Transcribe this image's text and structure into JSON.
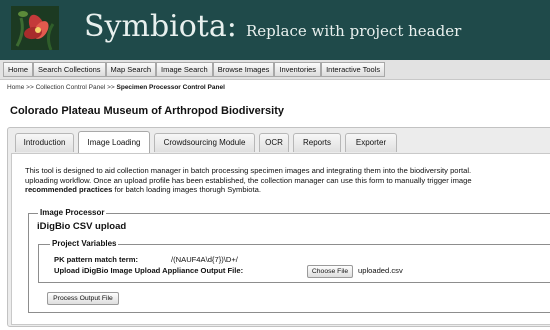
{
  "header": {
    "title": "Symbiota:",
    "subtitle": "Replace with project header"
  },
  "nav": {
    "items": [
      "Home",
      "Search Collections",
      "Map Search",
      "Image Search",
      "Browse Images",
      "Inventories",
      "Interactive Tools"
    ]
  },
  "breadcrumb": {
    "home": "Home",
    "sep1": ">>",
    "collection_panel": "Collection Control Panel",
    "sep2": ">>",
    "current": "Specimen Processor Control Panel"
  },
  "page": {
    "title": "Colorado Plateau Museum of Arthropod Biodiversity"
  },
  "tabs": [
    "Introduction",
    "Image Loading",
    "Crowdsourcing Module",
    "OCR",
    "Reports",
    "Exporter"
  ],
  "active_tab": "Image Loading",
  "description": {
    "line1": "This tool is designed to aid collection manager in batch processing specimen images and integrating them into the biodiversity portal.",
    "line2": "uploading workflow. Once an upload profile has been established, the collection manager can use this form to manually trigger image",
    "line3_bold": "recommended practices",
    "line3_rest": " for batch loading images thorugh Symbiota."
  },
  "image_processor": {
    "legend": "Image Processor",
    "title": "iDigBio CSV upload",
    "project_variables": {
      "legend": "Project Variables",
      "pk_label": "PK pattern match term:",
      "pk_value": "/(NAUF4A\\d{7})\\D+/",
      "upload_label": "Upload iDigBio Image Upload Appliance Output File:",
      "choose_file_label": "Choose File",
      "file_name": "uploaded.csv"
    },
    "process_button": "Process Output File"
  }
}
